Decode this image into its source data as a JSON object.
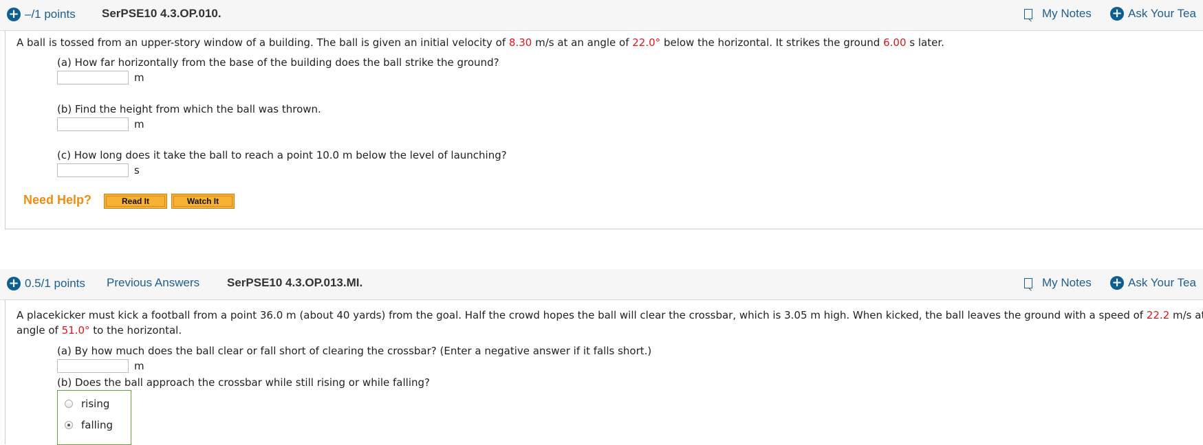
{
  "q1": {
    "points": "–/1 points",
    "qid": "SerPSE10 4.3.OP.010.",
    "my_notes": "My Notes",
    "ask_teacher": "Ask Your Tea",
    "stem": {
      "t1": "A ball is tossed from an upper-story window of a building. The ball is given an initial velocity of ",
      "v1": "8.30",
      "t2": " m/s at an angle of ",
      "v2": "22.0°",
      "t3": " below the horizontal. It strikes the ground ",
      "v3": "6.00",
      "t4": " s later."
    },
    "parts": [
      {
        "label": "(a) How far horizontally from the base of the building does the ball strike the ground?",
        "value": "",
        "unit": "m"
      },
      {
        "label": "(b) Find the height from which the ball was thrown.",
        "value": "",
        "unit": "m"
      },
      {
        "label": "(c) How long does it take the ball to reach a point 10.0 m below the level of launching?",
        "value": "",
        "unit": "s"
      }
    ],
    "need_help": "Need Help?",
    "read_it": "Read It",
    "watch_it": "Watch It"
  },
  "q2": {
    "points": "0.5/1 points",
    "previous_answers": "Previous Answers",
    "qid": "SerPSE10 4.3.OP.013.MI.",
    "my_notes": "My Notes",
    "ask_teacher": "Ask Your Tea",
    "stem": {
      "t1": "A placekicker must kick a football from a point 36.0 m (about 40 yards) from the goal. Half the crowd hopes the ball will clear the crossbar, which is 3.05 m high. When kicked, the ball leaves the ground with a speed of ",
      "v1": "22.2",
      "t2": " m/s at an",
      "t3": "angle of ",
      "v2": "51.0°",
      "t4": " to the horizontal."
    },
    "parts": [
      {
        "label": "(a) By how much does the ball clear or fall short of clearing the crossbar? (Enter a negative answer if it falls short.)",
        "value": "",
        "unit": "m"
      },
      {
        "label": "(b) Does the ball approach the crossbar while still rising or while falling?"
      }
    ],
    "options": [
      {
        "label": "rising",
        "selected": false
      },
      {
        "label": "falling",
        "selected": true
      }
    ]
  }
}
